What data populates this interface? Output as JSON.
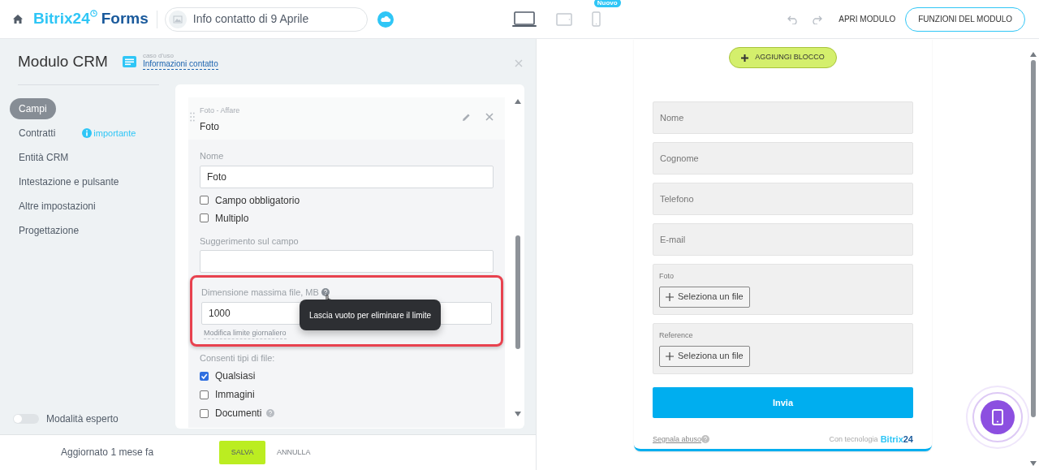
{
  "header": {
    "logo_main": "Bitrix24",
    "logo_sub": "Forms",
    "form_name": "Info contatto di 9 Aprile",
    "devices": [
      {
        "kind": "laptop",
        "selected": true
      },
      {
        "kind": "tablet",
        "selected": false
      },
      {
        "kind": "phone",
        "selected": false,
        "badge": "Nuovo"
      }
    ],
    "open_link": "APRI MODULO",
    "functions_button": "FUNZIONI DEL MODULO"
  },
  "panel": {
    "title": "Modulo CRM",
    "use_case_label": "caso d'uso",
    "use_case_link": "Informazioni contatto",
    "nav": [
      {
        "label": "Campi",
        "selected": true
      },
      {
        "label": "Contratti",
        "selected": false,
        "note": "importante"
      },
      {
        "label": "Entità CRM",
        "selected": false
      },
      {
        "label": "Intestazione e pulsante",
        "selected": false
      },
      {
        "label": "Altre impostazioni",
        "selected": false
      },
      {
        "label": "Progettazione",
        "selected": false
      }
    ],
    "expert_mode": {
      "label": "Modalità esperto",
      "on": false
    }
  },
  "field": {
    "caption": "Foto - Affare",
    "title": "Foto",
    "name_label": "Nome",
    "name_value": "Foto",
    "options": [
      {
        "label": "Campo obbligatorio",
        "checked": false
      },
      {
        "label": "Multiplo",
        "checked": false
      }
    ],
    "hint_label": "Suggerimento sul campo",
    "size_label": "Dimensione massima file, MB",
    "size_value": "1000",
    "limit_link": "Modifica limite giornaliero",
    "tooltip": "Lascia vuoto per eliminare il limite",
    "types_label": "Consenti tipi di file:",
    "types": [
      {
        "label": "Qualsiasi",
        "checked": true,
        "help": false
      },
      {
        "label": "Immagini",
        "checked": false,
        "help": false
      },
      {
        "label": "Documenti",
        "checked": false,
        "help": true
      }
    ]
  },
  "footer": {
    "updated": "Aggiornato 1 mese fa",
    "save": "SALVA",
    "cancel": "ANNULLA"
  },
  "preview": {
    "add_block": "AGGIUNGI BLOCCO",
    "fields": [
      {
        "kind": "text",
        "placeholder": "Nome"
      },
      {
        "kind": "text",
        "placeholder": "Cognome"
      },
      {
        "kind": "text",
        "placeholder": "Telefono"
      },
      {
        "kind": "text",
        "placeholder": "E-mail"
      },
      {
        "kind": "file",
        "label": "Foto",
        "button": "Seleziona un file"
      },
      {
        "kind": "file",
        "label": "Reference",
        "button": "Seleziona un file"
      }
    ],
    "submit": "Invia",
    "report_link": "Segnala abuso",
    "powered_by": "Con tecnologia",
    "brand_a": "Bitrix",
    "brand_b": "24"
  }
}
